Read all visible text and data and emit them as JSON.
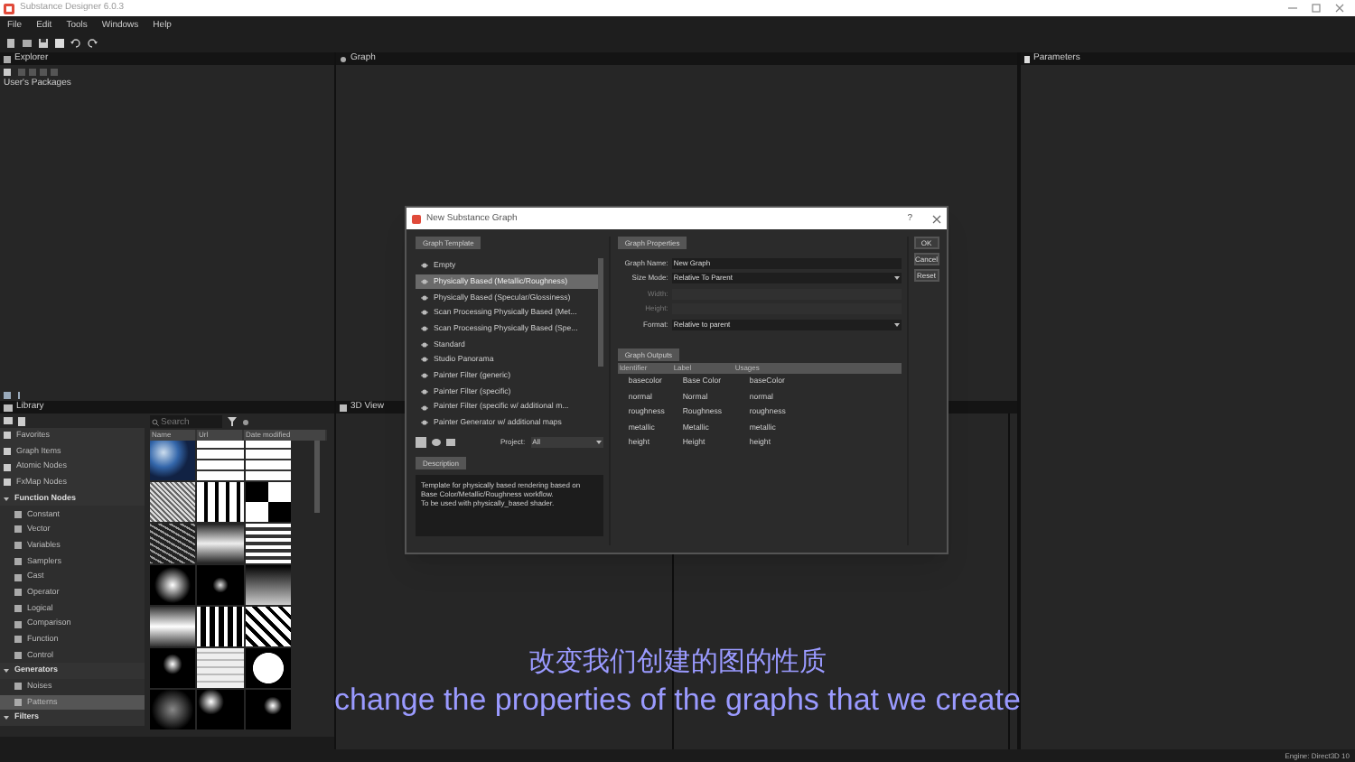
{
  "window": {
    "title": "Substance Designer 6.0.3"
  },
  "menu": [
    "File",
    "Edit",
    "Tools",
    "Windows",
    "Help"
  ],
  "explorer": {
    "title": "Explorer",
    "items": [
      "User's Packages"
    ]
  },
  "graph": {
    "title": "Graph"
  },
  "parameters": {
    "title": "Parameters"
  },
  "view3d": {
    "title": "3D View"
  },
  "library": {
    "title": "Library",
    "search": {
      "placeholder": "Search"
    },
    "columns": [
      "Name",
      "Url",
      "Date modified"
    ],
    "tree": [
      {
        "label": "Favorites",
        "selected": false
      },
      {
        "label": "Graph Items",
        "selected": false
      },
      {
        "label": "Atomic Nodes",
        "selected": false
      },
      {
        "label": "FxMap Nodes",
        "selected": false
      },
      {
        "label": "Function Nodes",
        "selected": false,
        "expanded": true,
        "children": [
          {
            "label": "Constant",
            "selected": false
          },
          {
            "label": "Vector",
            "selected": false
          },
          {
            "label": "Variables",
            "selected": false
          },
          {
            "label": "Samplers",
            "selected": false
          },
          {
            "label": "Cast",
            "selected": false
          },
          {
            "label": "Operator",
            "selected": false
          },
          {
            "label": "Logical",
            "selected": false
          },
          {
            "label": "Comparison",
            "selected": false
          },
          {
            "label": "Function",
            "selected": false
          },
          {
            "label": "Control",
            "selected": false
          }
        ]
      },
      {
        "label": "Generators",
        "selected": false,
        "expanded": true,
        "children": [
          {
            "label": "Noises",
            "selected": false
          },
          {
            "label": "Patterns",
            "selected": true
          }
        ]
      },
      {
        "label": "Filters",
        "selected": false,
        "expanded": true
      }
    ]
  },
  "dialog": {
    "title": "New Substance Graph",
    "help": "?",
    "template_tab": "Graph Template",
    "templates": [
      {
        "label": "Empty",
        "selected": false
      },
      {
        "label": "Physically Based (Metallic/Roughness)",
        "selected": true
      },
      {
        "label": "Physically Based (Specular/Glossiness)",
        "selected": false
      },
      {
        "label": "Scan Processing Physically Based (Met...",
        "selected": false
      },
      {
        "label": "Scan Processing Physically Based (Spe...",
        "selected": false
      },
      {
        "label": "Standard",
        "selected": false
      },
      {
        "label": "Studio Panorama",
        "selected": false
      },
      {
        "label": "Painter Filter (generic)",
        "selected": false
      },
      {
        "label": "Painter Filter (specific)",
        "selected": false
      },
      {
        "label": "Painter Filter (specific w/ additional m...",
        "selected": false
      },
      {
        "label": "Painter Generator w/ additional maps",
        "selected": false
      }
    ],
    "project_label": "Project:",
    "project_value": "All",
    "description_tab": "Description",
    "description": "Template for physically based rendering based on Base Color/Metallic/Roughness workflow.\nTo be used with physically_based shader.",
    "properties_tab": "Graph Properties",
    "fields": [
      {
        "label": "Graph Name:",
        "kind": "text",
        "value": "New Graph",
        "disabled": false
      },
      {
        "label": "Size Mode:",
        "kind": "dropdown",
        "value": "Relative To Parent",
        "disabled": false
      },
      {
        "label": "Width:",
        "kind": "text",
        "disabled": true
      },
      {
        "label": "Height:",
        "kind": "text",
        "disabled": true
      },
      {
        "label": "Format:",
        "kind": "dropdown",
        "value": "Relative to parent",
        "disabled": false
      }
    ],
    "outputs_tab": "Graph Outputs",
    "outputs_columns": [
      "Identifier",
      "Label",
      "Usages"
    ],
    "outputs": [
      [
        "basecolor",
        "Base Color",
        "baseColor"
      ],
      [
        "normal",
        "Normal",
        "normal"
      ],
      [
        "roughness",
        "Roughness",
        "roughness"
      ],
      [
        "metallic",
        "Metallic",
        "metallic"
      ],
      [
        "height",
        "Height",
        "height"
      ]
    ],
    "buttons": [
      "OK",
      "Cancel",
      "Reset"
    ]
  },
  "subtitles": [
    "改变我们创建的图的性质",
    "change the properties of the graphs that we create"
  ],
  "status_bar": "Engine: Direct3D 10"
}
